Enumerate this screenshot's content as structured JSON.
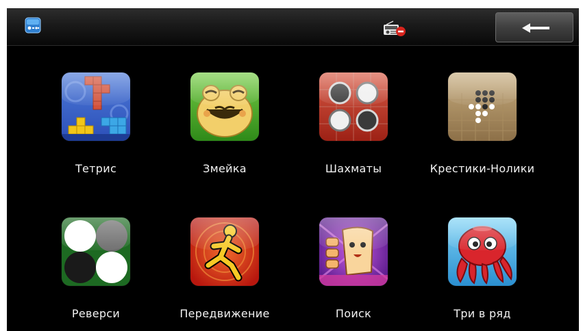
{
  "statusbar": {
    "menu_icon": "games-folder-icon",
    "radio_icon": "fm-radio-muted-icon",
    "back_icon": "back-arrow-icon"
  },
  "apps": [
    {
      "label": "Тетрис",
      "icon": "tetris-icon"
    },
    {
      "label": "Змейка",
      "icon": "snake-frog-icon"
    },
    {
      "label": "Шахматы",
      "icon": "checkers-icon"
    },
    {
      "label": "Крестики-Нолики",
      "icon": "tic-tac-toe-icon"
    },
    {
      "label": "Реверси",
      "icon": "reversi-icon"
    },
    {
      "label": "Передвижение",
      "icon": "running-man-icon"
    },
    {
      "label": "Поиск",
      "icon": "search-character-icon"
    },
    {
      "label": "Три в ряд",
      "icon": "octopus-icon"
    }
  ]
}
